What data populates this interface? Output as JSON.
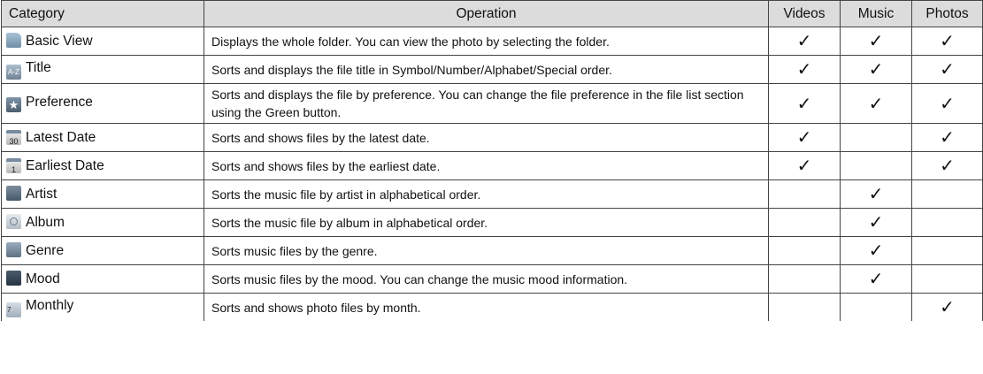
{
  "header": {
    "category": "Category",
    "operation": "Operation",
    "videos": "Videos",
    "music": "Music",
    "photos": "Photos"
  },
  "check_mark": "✓",
  "rows": [
    {
      "icon": "folder-icon",
      "category": "Basic View",
      "operation": "Displays the whole folder. You can view the photo by selecting the folder.",
      "videos": true,
      "music": true,
      "photos": true
    },
    {
      "icon": "sort-az-icon",
      "icon_text": "A-Z",
      "category": "Title",
      "operation": "Sorts and displays the file title in Symbol/Number/Alphabet/Special order.",
      "videos": true,
      "music": true,
      "photos": true
    },
    {
      "icon": "star-icon",
      "icon_text": "★",
      "category": "Preference",
      "operation": "Sorts and displays the file by preference. You can change the file preference in the file list section using the Green button.",
      "videos": true,
      "music": true,
      "photos": true
    },
    {
      "icon": "calendar-30-icon",
      "icon_text": "30",
      "category": "Latest Date",
      "operation": "Sorts and shows files by the latest date.",
      "videos": true,
      "music": false,
      "photos": true
    },
    {
      "icon": "calendar-1-icon",
      "icon_text": "1",
      "category": "Earliest Date",
      "operation": "Sorts and shows files by the earliest date.",
      "videos": true,
      "music": false,
      "photos": true
    },
    {
      "icon": "artist-icon",
      "category": "Artist",
      "operation": "Sorts the music file by artist in alphabetical order.",
      "videos": false,
      "music": true,
      "photos": false
    },
    {
      "icon": "album-icon",
      "category": "Album",
      "operation": "Sorts the music file by album in alphabetical order.",
      "videos": false,
      "music": true,
      "photos": false
    },
    {
      "icon": "genre-icon",
      "category": "Genre",
      "operation": "Sorts music files by the genre.",
      "videos": false,
      "music": true,
      "photos": false
    },
    {
      "icon": "mood-icon",
      "category": "Mood",
      "operation": "Sorts music files by the mood. You can change the music mood information.",
      "videos": false,
      "music": true,
      "photos": false
    },
    {
      "icon": "calendar-month-icon",
      "icon_text": "7",
      "category": "Monthly",
      "operation": "Sorts and shows photo files by month.",
      "videos": false,
      "music": false,
      "photos": true
    }
  ]
}
